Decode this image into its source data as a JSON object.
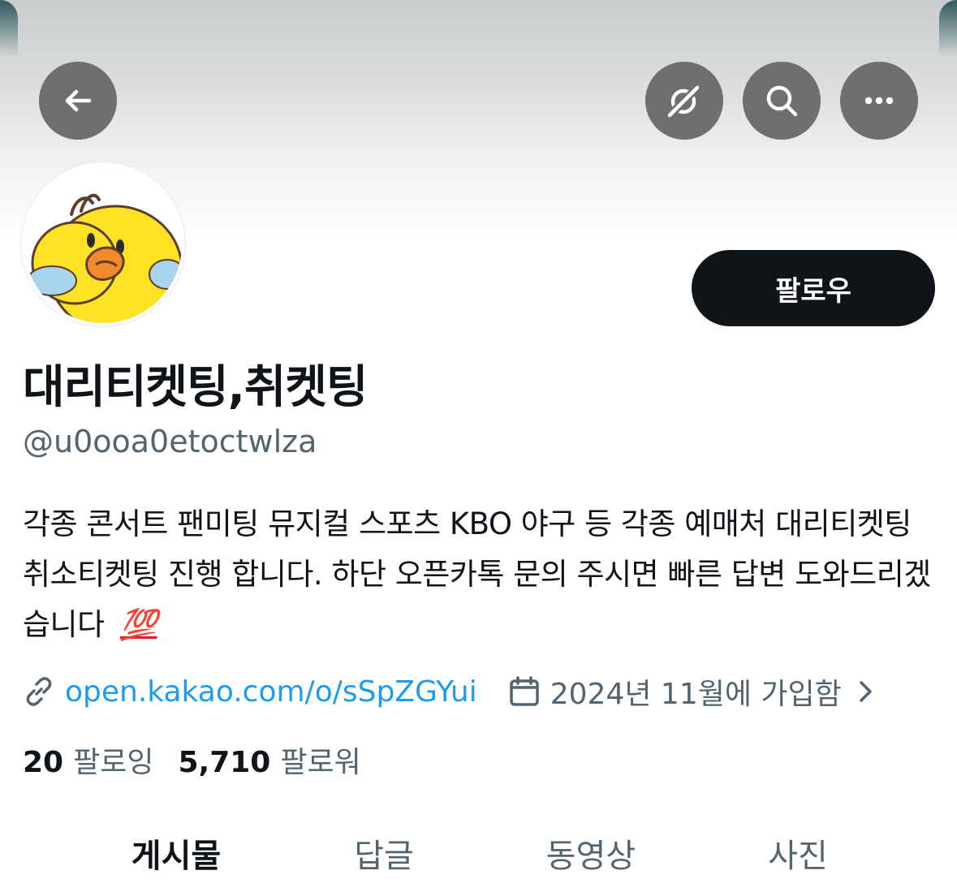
{
  "icons": {
    "back": "arrow-left-icon",
    "grok": "grok-icon",
    "search": "search-icon",
    "more": "more-horizontal-icon",
    "link": "link-icon",
    "calendar": "calendar-icon",
    "chevron": "chevron-right-icon",
    "bio_emoji": "hundred-points-icon"
  },
  "colors": {
    "accent_link": "#1d9bf0",
    "follow_button_bg": "#0f1419",
    "secondary_text": "#536471"
  },
  "profile": {
    "follow_label": "팔로우",
    "display_name": "대리티켓팅,취켓팅",
    "handle": "@u0ooa0etoctwlza",
    "bio": "각종 콘서트 팬미팅 뮤지컬 스포츠 KBO 야구 등 각종 예매처 대리티켓팅 취소티켓팅 진행 합니다. 하단 오픈카톡 문의 주시면 빠른 답변 도와드리겠습니다",
    "bio_emoji": "💯",
    "link": "open.kakao.com/o/sSpZGYui",
    "joined": "2024년 11월에 가입함"
  },
  "stats": {
    "following_count": "20",
    "following_label": "팔로잉",
    "followers_count": "5,710",
    "followers_label": "팔로워"
  },
  "tabs": [
    {
      "label": "게시물",
      "active": true
    },
    {
      "label": "답글",
      "active": false
    },
    {
      "label": "동영상",
      "active": false
    },
    {
      "label": "사진",
      "active": false
    }
  ]
}
